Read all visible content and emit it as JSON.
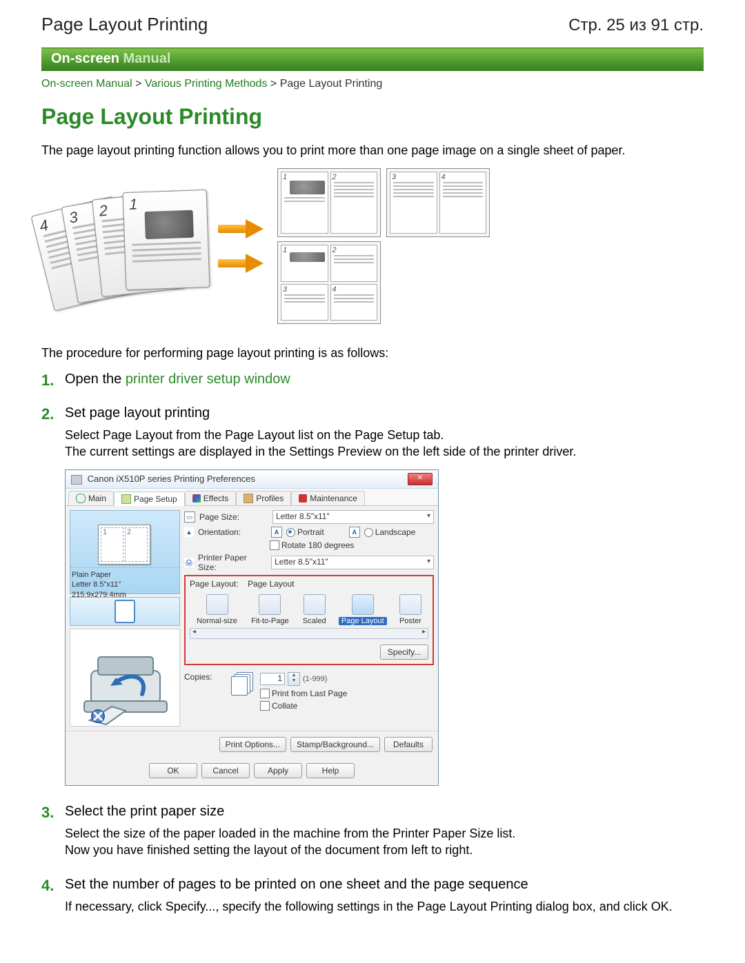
{
  "top": {
    "left": "Page Layout Printing",
    "right": "Стр. 25 из 91 стр."
  },
  "greenbar": {
    "on": "On-screen",
    "manual": "Manual"
  },
  "breadcrumb": {
    "a1": "On-screen Manual",
    "a2": "Various Printing Methods",
    "current": "Page Layout Printing",
    "sep": " > "
  },
  "h1": "Page Layout Printing",
  "intro": "The page layout printing function allows you to print more than one page image on a single sheet of paper.",
  "proc": "The procedure for performing page layout printing is as follows:",
  "steps": [
    {
      "title_pre": "Open the ",
      "title_link": "printer driver setup window"
    },
    {
      "title": "Set page layout printing",
      "body1": "Select Page Layout from the Page Layout list on the Page Setup tab.",
      "body2": "The current settings are displayed in the Settings Preview on the left side of the printer driver."
    },
    {
      "title": "Select the print paper size",
      "body1": "Select the size of the paper loaded in the machine from the Printer Paper Size list.",
      "body2": "Now you have finished setting the layout of the document from left to right."
    },
    {
      "title": "Set the number of pages to be printed on one sheet and the page sequence",
      "body1": "If necessary, click Specify..., specify the following settings in the Page Layout Printing dialog box, and click OK."
    }
  ],
  "dialog": {
    "title": "Canon iX510P series Printing Preferences",
    "close": "✕",
    "tabs": {
      "main": "Main",
      "page_setup": "Page Setup",
      "effects": "Effects",
      "profiles": "Profiles",
      "maintenance": "Maintenance"
    },
    "preview": {
      "p1": "1",
      "p2": "2",
      "label1": "Plain Paper",
      "label2": "Letter 8.5\"x11\" 215.9x279.4mm"
    },
    "form": {
      "page_size_lbl": "Page Size:",
      "page_size_val": "Letter 8.5\"x11\"",
      "orientation_lbl": "Orientation:",
      "orientation_icon": "A",
      "portrait": "Portrait",
      "landscape_icon": "A",
      "landscape": "Landscape",
      "rotate": "Rotate 180 degrees",
      "ppsize_lbl": "Printer Paper Size:",
      "ppsize_val": "Letter 8.5\"x11\"",
      "layout_lbl": "Page Layout:",
      "layout_val": "Page Layout",
      "options": {
        "normal": "Normal-size",
        "fit": "Fit-to-Page",
        "scaled": "Scaled",
        "page_layout": "Page Layout",
        "poster": "Poster"
      },
      "specify": "Specify...",
      "copies_lbl": "Copies:",
      "copies_val": "1",
      "copies_range": "(1-999)",
      "print_last": "Print from Last Page",
      "collate": "Collate"
    },
    "buttons": {
      "print_options": "Print Options...",
      "stamp": "Stamp/Background...",
      "defaults": "Defaults",
      "ok": "OK",
      "cancel": "Cancel",
      "apply": "Apply",
      "help": "Help"
    }
  }
}
